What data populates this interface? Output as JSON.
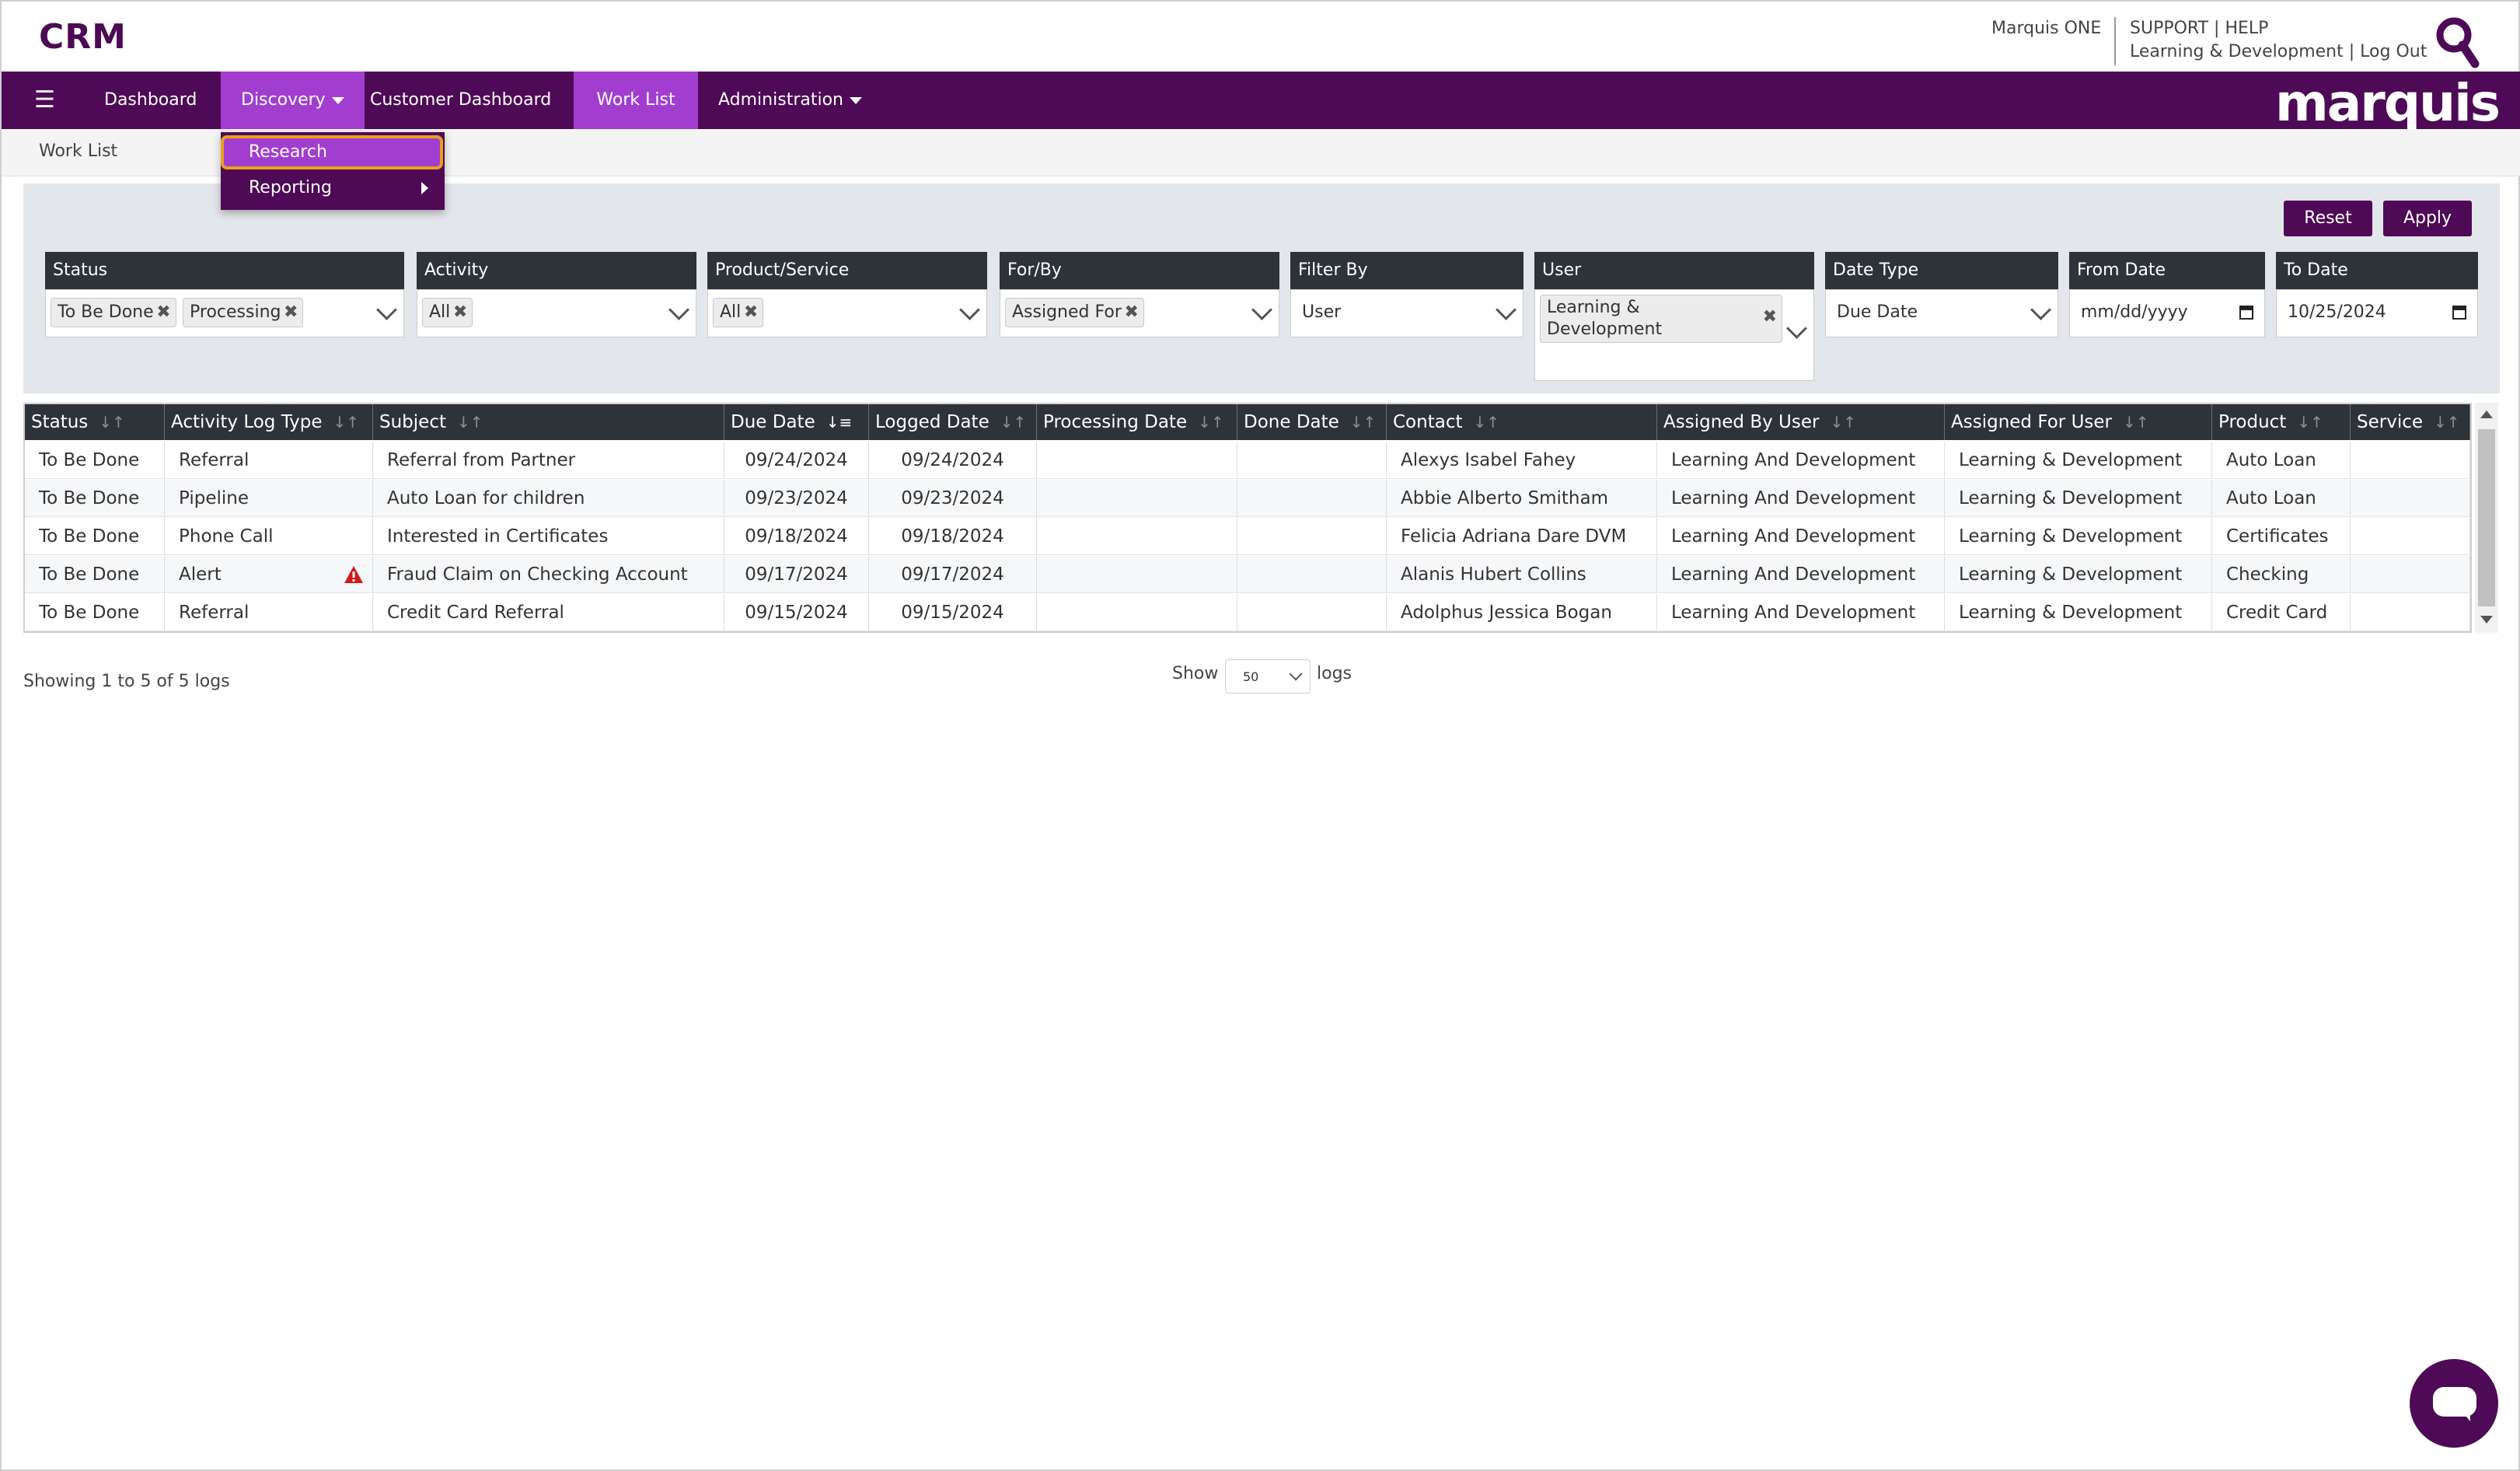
{
  "header": {
    "brand": "CRM",
    "user_org": "Marquis ONE",
    "links_line1": "SUPPORT | HELP",
    "links_line2": "Learning & Development | Log Out",
    "logo_text": "marquis"
  },
  "nav": {
    "items": [
      {
        "label": "Dashboard"
      },
      {
        "label": "Discovery"
      },
      {
        "label": "Customer Dashboard"
      },
      {
        "label": "Work List"
      },
      {
        "label": "Administration"
      }
    ],
    "discovery_menu": [
      {
        "label": "Research"
      },
      {
        "label": "Reporting"
      }
    ]
  },
  "breadcrumb": "Work List",
  "filters": {
    "reset_label": "Reset",
    "apply_label": "Apply",
    "status": {
      "label": "Status",
      "chips": [
        "To Be Done",
        "Processing"
      ]
    },
    "activity": {
      "label": "Activity",
      "chips": [
        "All"
      ]
    },
    "product": {
      "label": "Product/Service",
      "chips": [
        "All"
      ]
    },
    "forby": {
      "label": "For/By",
      "chips": [
        "Assigned For"
      ]
    },
    "filterby": {
      "label": "Filter By",
      "value": "User"
    },
    "user": {
      "label": "User",
      "chip_line1": "Learning &",
      "chip_line2": "Development"
    },
    "datetype": {
      "label": "Date Type",
      "value": "Due Date"
    },
    "fromdate": {
      "label": "From Date",
      "value": "mm/dd/yyyy"
    },
    "todate": {
      "label": "To Date",
      "value": "10/25/2024"
    }
  },
  "table": {
    "columns": [
      "Status",
      "Activity Log Type",
      "Subject",
      "Due Date",
      "Logged Date",
      "Processing Date",
      "Done Date",
      "Contact",
      "Assigned By User",
      "Assigned For User",
      "Product",
      "Service"
    ],
    "rows": [
      [
        "To Be Done",
        "Referral",
        "Referral from Partner",
        "09/24/2024",
        "09/24/2024",
        "",
        "",
        "Alexys Isabel Fahey",
        "Learning And Development",
        "Learning & Development",
        "Auto Loan",
        ""
      ],
      [
        "To Be Done",
        "Pipeline",
        "Auto Loan for children",
        "09/23/2024",
        "09/23/2024",
        "",
        "",
        "Abbie Alberto Smitham",
        "Learning And Development",
        "Learning & Development",
        "Auto Loan",
        ""
      ],
      [
        "To Be Done",
        "Phone Call",
        "Interested in Certificates",
        "09/18/2024",
        "09/18/2024",
        "",
        "",
        "Felicia Adriana Dare DVM",
        "Learning And Development",
        "Learning & Development",
        "Certificates",
        ""
      ],
      [
        "To Be Done",
        "Alert",
        "Fraud Claim on Checking Account",
        "09/17/2024",
        "09/17/2024",
        "",
        "",
        "Alanis Hubert Collins",
        "Learning And Development",
        "Learning & Development",
        "Checking",
        ""
      ],
      [
        "To Be Done",
        "Referral",
        "Credit Card Referral",
        "09/15/2024",
        "09/15/2024",
        "",
        "",
        "Adolphus Jessica Bogan",
        "Learning And Development",
        "Learning & Development",
        "Credit Card",
        ""
      ]
    ]
  },
  "footer": {
    "showing": "Showing 1 to 5 of 5 logs",
    "show_label": "Show",
    "page_size": "50",
    "logs_label": "logs"
  },
  "colors": {
    "brand": "#4e0a56",
    "accent": "#a23ecf",
    "highlight": "#e8a11d"
  },
  "icons": {
    "search": "search-icon",
    "menu": "hamburger-icon",
    "alert": "alert-triangle-icon",
    "chat": "chat-icon"
  }
}
